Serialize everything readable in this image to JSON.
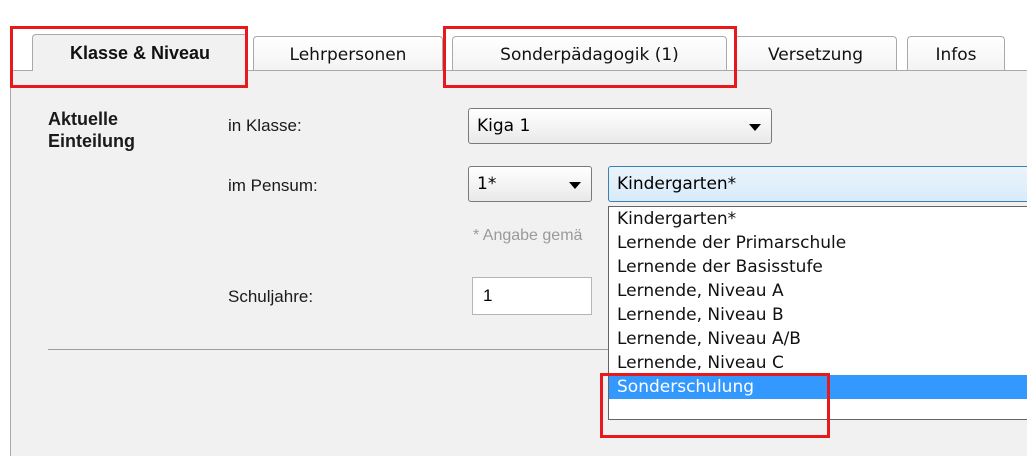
{
  "tabs": [
    {
      "label": "Klasse & Niveau",
      "active": true
    },
    {
      "label": "Lehrpersonen",
      "active": false
    },
    {
      "label": "Sonderpädagogik (1)",
      "active": false
    },
    {
      "label": "Versetzung",
      "active": false
    },
    {
      "label": "Infos",
      "active": false
    }
  ],
  "section": {
    "heading_line1": "Aktuelle",
    "heading_line2": "Einteilung"
  },
  "form": {
    "klasse_label": "in Klasse:",
    "klasse_value": "Kiga 1",
    "pensum_label": "im Pensum:",
    "pensum_value": "1*",
    "niveau_value": "Kindergarten*",
    "hint": "* Angabe gemä",
    "schuljahre_label": "Schuljahre:",
    "schuljahre_value": "1"
  },
  "dropdown": {
    "options": [
      "Kindergarten*",
      "Lernende der Primarschule",
      "Lernende der Basisstufe",
      "Lernende, Niveau A",
      "Lernende, Niveau B",
      "Lernende, Niveau A/B",
      "Lernende, Niveau C",
      "Sonderschulung"
    ],
    "selected_index": 7
  },
  "colors": {
    "highlight": "#e8191c",
    "selection": "#3399ff"
  }
}
